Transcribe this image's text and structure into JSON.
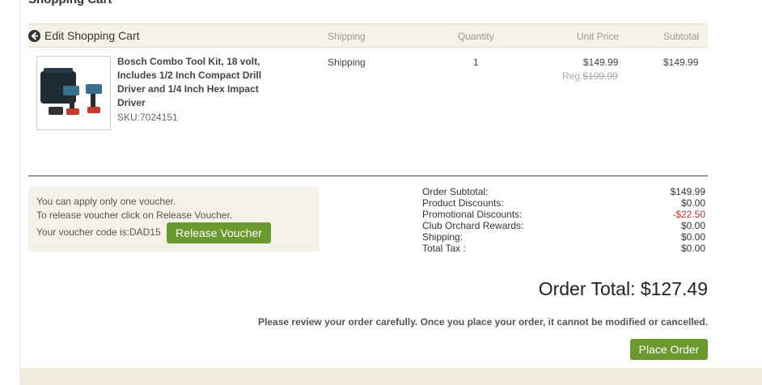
{
  "page": {
    "title": "Shopping Cart"
  },
  "cart_header": {
    "edit_label": "Edit Shopping Cart",
    "columns": [
      "Shipping",
      "Quantity",
      "Unit Price",
      "Subtotal"
    ]
  },
  "item": {
    "name": "Bosch Combo Tool Kit, 18 volt, Includes 1/2 Inch Compact Drill Driver and 1/4 Inch Hex Impact Driver",
    "sku": "SKU:7024151",
    "shipping": "Shipping",
    "quantity": "1",
    "unit_price": "$149.99",
    "reg_label": "Reg.",
    "reg_price": "$199.99",
    "subtotal": "$149.99"
  },
  "voucher": {
    "line1": "You can apply only one voucher.",
    "line2": "To release voucher click on Release Voucher.",
    "code_text": "Your voucher code is:DAD15",
    "release_label": "Release Voucher"
  },
  "summary": [
    {
      "label": "Order Subtotal:",
      "value": "$149.99"
    },
    {
      "label": "Product Discounts:",
      "value": "$0.00"
    },
    {
      "label": "Promotional Discounts:",
      "value": "-$22.50"
    },
    {
      "label": "Club Orchard Rewards:",
      "value": "$0.00"
    },
    {
      "label": "Shipping:",
      "value": "$0.00"
    },
    {
      "label": "Total Tax :",
      "value": "$0.00"
    }
  ],
  "order_total": "Order Total: $127.49",
  "notice": "Please review your order carefully. Once you place your order, it cannot be modified or cancelled.",
  "place_order_label": "Place Order",
  "colors": {
    "accent_green": "#6a9a2e",
    "panel_beige": "#f6f1e6",
    "discount_red": "#c0392b"
  }
}
